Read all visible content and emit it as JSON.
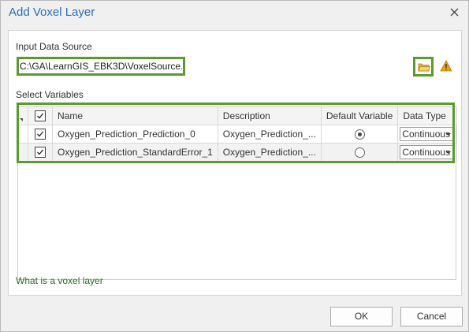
{
  "dialog": {
    "title": "Add Voxel Layer",
    "close_icon": "close-icon"
  },
  "input_source": {
    "label": "Input Data Source",
    "value": "C:\\GA\\LearnGIS_EBK3D\\VoxelSource.nc",
    "browse_icon": "folder-icon",
    "warning_icon": "warning-icon"
  },
  "variables": {
    "label": "Select Variables",
    "columns": [
      "Name",
      "Description",
      "Default Variable",
      "Data Type"
    ],
    "rows": [
      {
        "checked": true,
        "name": "Oxygen_Prediction_Prediction_0",
        "description": "Oxygen_Prediction_...",
        "default": true,
        "data_type": "Continuous"
      },
      {
        "checked": true,
        "name": "Oxygen_Prediction_StandardError_1",
        "description": "Oxygen_Prediction_...",
        "default": false,
        "data_type": "Continuous"
      }
    ]
  },
  "help_link": "What is a voxel layer",
  "buttons": {
    "ok": "OK",
    "cancel": "Cancel"
  },
  "colors": {
    "accent_highlight": "#5c9a2e",
    "title": "#2a6ebb",
    "link": "#2f6b2c",
    "warning": "#e8a317"
  }
}
